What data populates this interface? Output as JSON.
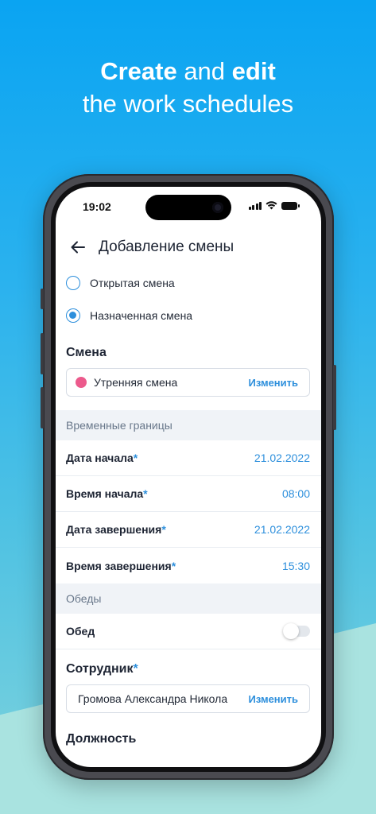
{
  "headline": {
    "line1_bold1": "Create",
    "line1_mid": " and ",
    "line1_bold2": "edit",
    "line2": "the work schedules"
  },
  "status_bar": {
    "time": "19:02"
  },
  "app_bar": {
    "title": "Добавление смены",
    "back_icon": "arrow-left-icon"
  },
  "shift_type": {
    "options": [
      {
        "label": "Открытая смена",
        "checked": false
      },
      {
        "label": "Назначенная смена",
        "checked": true
      }
    ]
  },
  "shift": {
    "section_title": "Смена",
    "selected": "Утренняя смена",
    "dot_color": "#ec5a8c",
    "change_label": "Изменить"
  },
  "time_bounds": {
    "header": "Временные границы",
    "rows": [
      {
        "label": "Дата начала",
        "value": "21.02.2022"
      },
      {
        "label": "Время начала",
        "value": "08:00"
      },
      {
        "label": "Дата завершения",
        "value": "21.02.2022"
      },
      {
        "label": "Время завершения",
        "value": "15:30"
      }
    ],
    "required_mark": "*"
  },
  "lunch": {
    "header": "Обеды",
    "label": "Обед",
    "enabled": false
  },
  "employee": {
    "section_title": "Сотрудник",
    "required_mark": "*",
    "selected": "Громова Александра Никола",
    "change_label": "Изменить"
  },
  "position": {
    "section_title": "Должность"
  },
  "colors": {
    "accent": "#2d8fdc",
    "background_top": "#0aa4f2",
    "background_bottom": "#a9e3e0"
  }
}
